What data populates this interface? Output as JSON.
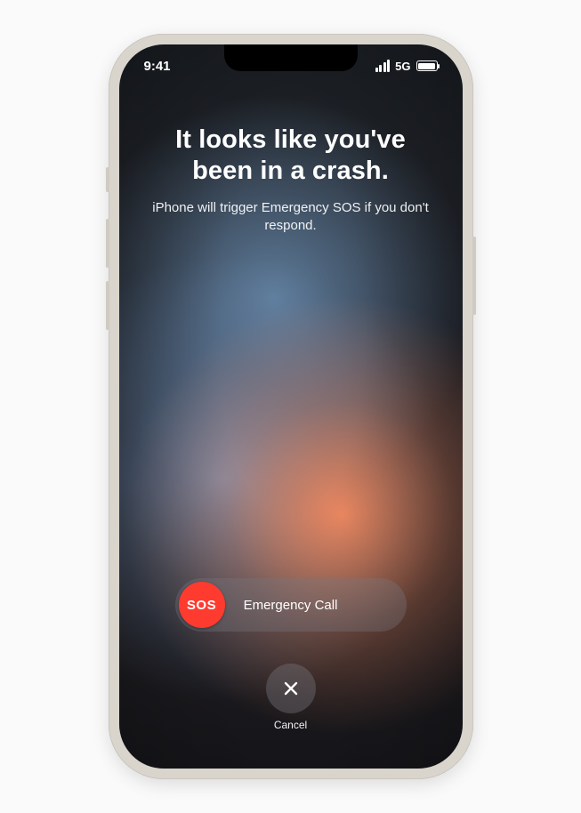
{
  "status": {
    "time": "9:41",
    "network": "5G"
  },
  "crash": {
    "headline": "It looks like you've been in a crash.",
    "subtext": "iPhone will trigger Emergency SOS if you don't respond."
  },
  "slider": {
    "chip": "SOS",
    "label": "Emergency Call"
  },
  "cancel": {
    "label": "Cancel"
  }
}
